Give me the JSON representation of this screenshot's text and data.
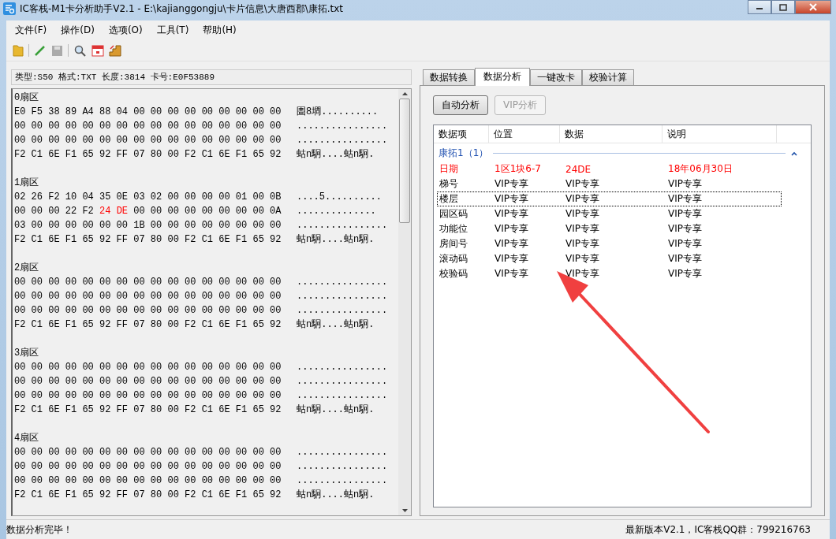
{
  "window": {
    "title": "IC客栈-M1卡分析助手V2.1 - E:\\kajianggongju\\卡片信息\\大唐西郡\\康拓.txt"
  },
  "menu": [
    "文件(F)",
    "操作(D)",
    "选项(O)",
    "工具(T)",
    "帮助(H)"
  ],
  "card_info": "类型:S50 格式:TXT 长度:3814 卡号:E0F53889",
  "sectors": [
    {
      "title": "0扇区",
      "lines": [
        {
          "hex": "E0 F5 38 89 A4 88 04 00 00 00 00 00 00 00 00 00",
          "ascii": "圕8墹.........."
        },
        {
          "hex": "00 00 00 00 00 00 00 00 00 00 00 00 00 00 00 00",
          "ascii": "................"
        },
        {
          "hex": "00 00 00 00 00 00 00 00 00 00 00 00 00 00 00 00",
          "ascii": "................"
        },
        {
          "hex": "F2 C1 6E F1 65 92 FF 07 80 00 F2 C1 6E F1 65 92",
          "ascii": "蛄n駉....蛄n駉."
        }
      ]
    },
    {
      "title": "1扇区",
      "lines": [
        {
          "hex": "02 26 F2 10 04 35 0E 03 02 00 00 00 00 01 00 0B",
          "ascii": "....5.........."
        },
        {
          "segments": [
            {
              "text": "00 00 00 22 F2 ",
              "highlighted": false
            },
            {
              "text": "24 DE",
              "highlighted": true
            },
            {
              "text": " 00 00 00 00 00 00 00 00 0A",
              "highlighted": false
            }
          ],
          "ascii": ".............."
        },
        {
          "hex": "03 00 00 00 00 00 00 1B 00 00 00 00 00 00 00 00",
          "ascii": "................"
        },
        {
          "hex": "F2 C1 6E F1 65 92 FF 07 80 00 F2 C1 6E F1 65 92",
          "ascii": "蛄n駉....蛄n駉."
        }
      ]
    },
    {
      "title": "2扇区",
      "lines": [
        {
          "hex": "00 00 00 00 00 00 00 00 00 00 00 00 00 00 00 00",
          "ascii": "................"
        },
        {
          "hex": "00 00 00 00 00 00 00 00 00 00 00 00 00 00 00 00",
          "ascii": "................"
        },
        {
          "hex": "00 00 00 00 00 00 00 00 00 00 00 00 00 00 00 00",
          "ascii": "................"
        },
        {
          "hex": "F2 C1 6E F1 65 92 FF 07 80 00 F2 C1 6E F1 65 92",
          "ascii": "蛄n駉....蛄n駉."
        }
      ]
    },
    {
      "title": "3扇区",
      "lines": [
        {
          "hex": "00 00 00 00 00 00 00 00 00 00 00 00 00 00 00 00",
          "ascii": "................"
        },
        {
          "hex": "00 00 00 00 00 00 00 00 00 00 00 00 00 00 00 00",
          "ascii": "................"
        },
        {
          "hex": "00 00 00 00 00 00 00 00 00 00 00 00 00 00 00 00",
          "ascii": "................"
        },
        {
          "hex": "F2 C1 6E F1 65 92 FF 07 80 00 F2 C1 6E F1 65 92",
          "ascii": "蛄n駉....蛄n駉."
        }
      ]
    },
    {
      "title": "4扇区",
      "lines": [
        {
          "hex": "00 00 00 00 00 00 00 00 00 00 00 00 00 00 00 00",
          "ascii": "................"
        },
        {
          "hex": "00 00 00 00 00 00 00 00 00 00 00 00 00 00 00 00",
          "ascii": "................"
        },
        {
          "hex": "00 00 00 00 00 00 00 00 00 00 00 00 00 00 00 00",
          "ascii": "................"
        },
        {
          "hex": "F2 C1 6E F1 65 92 FF 07 80 00 F2 C1 6E F1 65 92",
          "ascii": "蛄n駉....蛄n駉."
        }
      ]
    }
  ],
  "tabs": [
    {
      "label": "数据转换",
      "selected": false
    },
    {
      "label": "数据分析",
      "selected": true
    },
    {
      "label": "一键改卡",
      "selected": false
    },
    {
      "label": "校验计算",
      "selected": false
    }
  ],
  "buttons": [
    {
      "label": "自动分析",
      "disabled": false
    },
    {
      "label": "VIP分析",
      "disabled": true
    }
  ],
  "table": {
    "columns": [
      "数据项",
      "位置",
      "数据",
      "说明"
    ],
    "group": {
      "label": "康拓1（1）",
      "expanded": true
    },
    "rows": [
      {
        "cells": [
          "日期",
          "1区1块6-7",
          "24DE",
          "18年06月30日"
        ],
        "highlighted": true,
        "selected": false
      },
      {
        "cells": [
          "梯号",
          "VIP专享",
          "VIP专享",
          "VIP专享"
        ],
        "highlighted": false,
        "selected": false
      },
      {
        "cells": [
          "楼层",
          "VIP专享",
          "VIP专享",
          "VIP专享"
        ],
        "highlighted": false,
        "selected": true
      },
      {
        "cells": [
          "园区码",
          "VIP专享",
          "VIP专享",
          "VIP专享"
        ],
        "highlighted": false,
        "selected": false
      },
      {
        "cells": [
          "功能位",
          "VIP专享",
          "VIP专享",
          "VIP专享"
        ],
        "highlighted": false,
        "selected": false
      },
      {
        "cells": [
          "房间号",
          "VIP专享",
          "VIP专享",
          "VIP专享"
        ],
        "highlighted": false,
        "selected": false
      },
      {
        "cells": [
          "滚动码",
          "VIP专享",
          "VIP专享",
          "VIP专享"
        ],
        "highlighted": false,
        "selected": false
      },
      {
        "cells": [
          "校验码",
          "VIP专享",
          "VIP专享",
          "VIP专享"
        ],
        "highlighted": false,
        "selected": false
      }
    ]
  },
  "status_bar": {
    "left": "数据分析完毕！",
    "right": "最新版本V2.1，IC客栈QQ群：799216763"
  }
}
